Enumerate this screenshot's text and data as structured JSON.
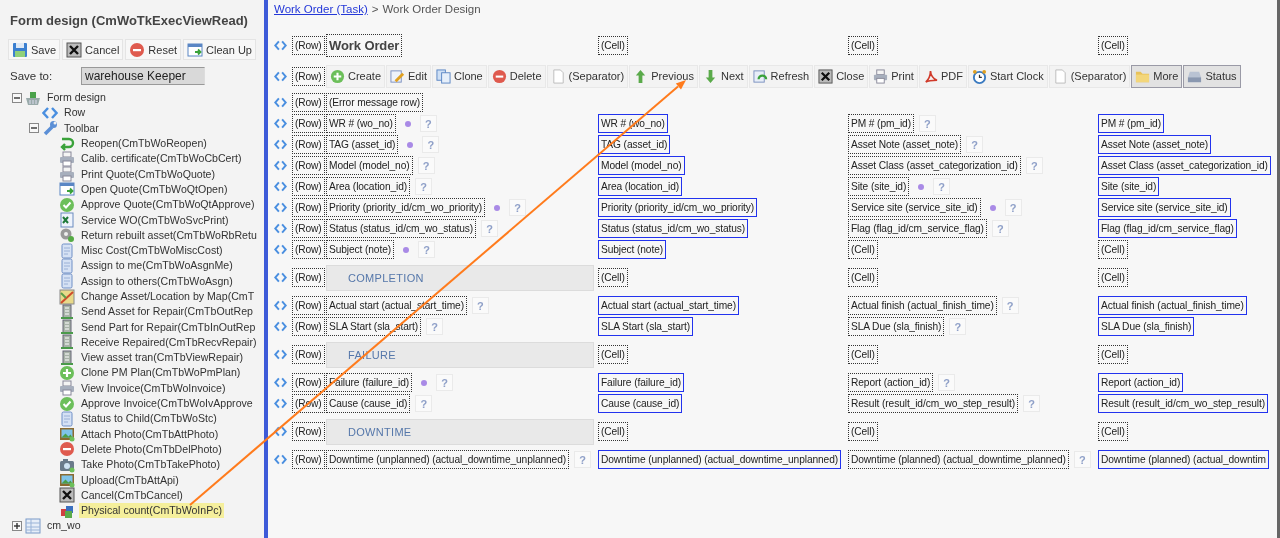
{
  "sidebar": {
    "title": "Form design (CmWoTkExecViewRead)",
    "buttons": [
      "Save",
      "Cancel",
      "Reset",
      "Clean Up"
    ],
    "save_to": {
      "label": "Save to:",
      "value": "warehouse Keeper"
    },
    "tree": [
      {
        "label": "Form design",
        "expanded": true,
        "selected": false,
        "children": [
          {
            "label": "Row",
            "selected": false
          },
          {
            "label": "Toolbar",
            "expanded": true,
            "selected": false,
            "children": [
              {
                "label": "Reopen(CmTbWoReopen)",
                "selected": false
              },
              {
                "label": "Calib. certificate(CmTbWoCbCert)",
                "selected": false
              },
              {
                "label": "Print Quote(CmTbWoQuote)",
                "selected": false
              },
              {
                "label": "Open Quote(CmTbWoQtOpen)",
                "selected": false
              },
              {
                "label": "Approve Quote(CmTbWoQtApprove)",
                "selected": false
              },
              {
                "label": "Service WO(CmTbWoSvcPrint)",
                "selected": false
              },
              {
                "label": "Return rebuilt asset(CmTbWoRbRetu",
                "selected": false
              },
              {
                "label": "Misc Cost(CmTbWoMiscCost)",
                "selected": false
              },
              {
                "label": "Assign to me(CmTbWoAsgnMe)",
                "selected": false
              },
              {
                "label": "Assign to others(CmTbWoAsgn)",
                "selected": false
              },
              {
                "label": "Change Asset/Location by Map(CmT",
                "selected": false
              },
              {
                "label": "Send Asset for Repair(CmTbOutRep",
                "selected": false
              },
              {
                "label": "Send Part for Repair(CmTbInOutRep",
                "selected": false
              },
              {
                "label": "Receive Repaired(CmTbRecvRepair)",
                "selected": false
              },
              {
                "label": "View asset tran(CmTbViewRepair)",
                "selected": false
              },
              {
                "label": "Clone PM Plan(CmTbWoPmPlan)",
                "selected": false
              },
              {
                "label": "View Invoice(CmTbWoInvoice)",
                "selected": false
              },
              {
                "label": "Approve Invoice(CmTbWoIvApprove",
                "selected": false
              },
              {
                "label": "Status to Child(CmTbWoStc)",
                "selected": false
              },
              {
                "label": "Attach Photo(CmTbAttPhoto)",
                "selected": false
              },
              {
                "label": "Delete Photo(CmTbDelPhoto)",
                "selected": false
              },
              {
                "label": "Take Photo(CmTbTakePhoto)",
                "selected": false
              },
              {
                "label": "Upload(CmTbAttApi)",
                "selected": false
              },
              {
                "label": "Cancel(CmTbCancel)",
                "selected": false
              },
              {
                "label": "Physical count(CmTbWoInPc)",
                "selected": true
              }
            ]
          }
        ]
      },
      {
        "label": "cm_wo",
        "expanded": false,
        "selected": false
      }
    ]
  },
  "breadcrumb": {
    "link": "Work Order (Task)",
    "separator": ">",
    "current": "Work Order Design"
  },
  "rows": [
    {
      "kind": "cells",
      "marker": "(Row)",
      "cells": [
        {
          "kind": "heading",
          "label": "Work Order"
        },
        {
          "kind": "label",
          "label": "(Cell)"
        },
        {
          "kind": "label",
          "label": "(Cell)"
        },
        {
          "kind": "label",
          "label": "(Cell)"
        }
      ]
    },
    {
      "kind": "toolbar",
      "marker": "(Row)",
      "buttons": [
        {
          "kind": "button",
          "label": "Create"
        },
        {
          "kind": "button",
          "label": "Edit"
        },
        {
          "kind": "button",
          "label": "Clone"
        },
        {
          "kind": "button",
          "label": "Delete"
        },
        {
          "kind": "button",
          "label": "(Separator)"
        },
        {
          "kind": "button",
          "label": "Previous"
        },
        {
          "kind": "button",
          "label": "Next"
        },
        {
          "kind": "button",
          "label": "Refresh"
        },
        {
          "kind": "button",
          "label": "Close"
        },
        {
          "kind": "button",
          "label": "Print"
        },
        {
          "kind": "button",
          "label": "PDF"
        },
        {
          "kind": "button",
          "label": "Start Clock"
        },
        {
          "kind": "button",
          "label": "(Separator)"
        },
        {
          "kind": "menu",
          "label": "More"
        },
        {
          "kind": "menu",
          "label": "Status"
        }
      ]
    },
    {
      "kind": "cells",
      "marker": "(Row)",
      "cells": [
        {
          "kind": "label",
          "label": "(Error message row)"
        }
      ]
    },
    {
      "kind": "cells",
      "marker": "(Row)",
      "cells": [
        {
          "kind": "label",
          "label": "WR # (wo_no)",
          "required": true,
          "help": "?"
        },
        {
          "kind": "field",
          "label": "WR # (wo_no)"
        },
        {
          "kind": "label",
          "label": "PM # (pm_id)",
          "required": false,
          "help": "?"
        },
        {
          "kind": "field",
          "label": "PM # (pm_id)"
        }
      ]
    },
    {
      "kind": "cells",
      "marker": "(Row)",
      "cells": [
        {
          "kind": "label",
          "label": "TAG (asset_id)",
          "required": true,
          "help": "?"
        },
        {
          "kind": "field",
          "label": "TAG (asset_id)"
        },
        {
          "kind": "label",
          "label": "Asset Note (asset_note)",
          "required": false,
          "help": "?"
        },
        {
          "kind": "field",
          "label": "Asset Note (asset_note)"
        }
      ]
    },
    {
      "kind": "cells",
      "marker": "(Row)",
      "cells": [
        {
          "kind": "label",
          "label": "Model (model_no)",
          "required": false,
          "help": "?"
        },
        {
          "kind": "field",
          "label": "Model (model_no)"
        },
        {
          "kind": "label",
          "label": "Asset Class (asset_categorization_id)",
          "required": false,
          "help": "?"
        },
        {
          "kind": "field",
          "label": "Asset Class (asset_categorization_id)"
        }
      ]
    },
    {
      "kind": "cells",
      "marker": "(Row)",
      "cells": [
        {
          "kind": "label",
          "label": "Area (location_id)",
          "required": false,
          "help": "?"
        },
        {
          "kind": "field",
          "label": "Area (location_id)"
        },
        {
          "kind": "label",
          "label": "Site (site_id)",
          "required": true,
          "help": "?"
        },
        {
          "kind": "field",
          "label": "Site (site_id)"
        }
      ]
    },
    {
      "kind": "cells",
      "marker": "(Row)",
      "cells": [
        {
          "kind": "label",
          "label": "Priority (priority_id/cm_wo_priority)",
          "required": true,
          "help": "?"
        },
        {
          "kind": "field",
          "label": "Priority (priority_id/cm_wo_priority)"
        },
        {
          "kind": "label",
          "label": "Service site (service_site_id)",
          "required": true,
          "help": "?"
        },
        {
          "kind": "field",
          "label": "Service site (service_site_id)"
        }
      ]
    },
    {
      "kind": "cells",
      "marker": "(Row)",
      "cells": [
        {
          "kind": "label",
          "label": "Status (status_id/cm_wo_status)",
          "required": false,
          "help": "?"
        },
        {
          "kind": "field",
          "label": "Status (status_id/cm_wo_status)"
        },
        {
          "kind": "label",
          "label": "Flag (flag_id/cm_service_flag)",
          "required": false,
          "help": "?"
        },
        {
          "kind": "field",
          "label": "Flag (flag_id/cm_service_flag)"
        }
      ]
    },
    {
      "kind": "cells",
      "marker": "(Row)",
      "cells": [
        {
          "kind": "label",
          "label": "Subject (note)",
          "required": true,
          "help": "?"
        },
        {
          "kind": "field",
          "label": "Subject (note)"
        },
        {
          "kind": "label",
          "label": "(Cell)"
        },
        {
          "kind": "label",
          "label": "(Cell)"
        }
      ]
    },
    {
      "kind": "section",
      "marker": "(Row)",
      "title": "COMPLETION",
      "cells": [
        {
          "kind": "label",
          "label": "(Cell)"
        },
        {
          "kind": "label",
          "label": "(Cell)"
        },
        {
          "kind": "label",
          "label": "(Cell)"
        }
      ]
    },
    {
      "kind": "cells",
      "marker": "(Row)",
      "cells": [
        {
          "kind": "label",
          "label": "Actual start (actual_start_time)",
          "required": false,
          "help": "?"
        },
        {
          "kind": "field",
          "label": "Actual start (actual_start_time)"
        },
        {
          "kind": "label",
          "label": "Actual finish (actual_finish_time)",
          "required": false,
          "help": "?"
        },
        {
          "kind": "field",
          "label": "Actual finish (actual_finish_time)"
        }
      ]
    },
    {
      "kind": "cells",
      "marker": "(Row)",
      "cells": [
        {
          "kind": "label",
          "label": "SLA Start (sla_start)",
          "required": false,
          "help": "?"
        },
        {
          "kind": "field",
          "label": "SLA Start (sla_start)"
        },
        {
          "kind": "label",
          "label": "SLA Due (sla_finish)",
          "required": false,
          "help": "?"
        },
        {
          "kind": "field",
          "label": "SLA Due (sla_finish)"
        }
      ]
    },
    {
      "kind": "section",
      "marker": "(Row)",
      "title": "FAILURE",
      "cells": [
        {
          "kind": "label",
          "label": "(Cell)"
        },
        {
          "kind": "label",
          "label": "(Cell)"
        },
        {
          "kind": "label",
          "label": "(Cell)"
        }
      ]
    },
    {
      "kind": "cells",
      "marker": "(Row)",
      "cells": [
        {
          "kind": "label",
          "label": "Failure (failure_id)",
          "required": true,
          "help": "?"
        },
        {
          "kind": "field",
          "label": "Failure (failure_id)"
        },
        {
          "kind": "label",
          "label": "Report (action_id)",
          "required": false,
          "help": "?"
        },
        {
          "kind": "field",
          "label": "Report (action_id)"
        }
      ]
    },
    {
      "kind": "cells",
      "marker": "(Row)",
      "cells": [
        {
          "kind": "label",
          "label": "Cause (cause_id)",
          "required": false,
          "help": "?"
        },
        {
          "kind": "field",
          "label": "Cause (cause_id)"
        },
        {
          "kind": "label",
          "label": "Result (result_id/cm_wo_step_result)",
          "required": false,
          "help": "?"
        },
        {
          "kind": "field",
          "label": "Result (result_id/cm_wo_step_result)"
        }
      ]
    },
    {
      "kind": "section",
      "marker": "(Row)",
      "title": "DOWNTIME",
      "cells": [
        {
          "kind": "label",
          "label": "(Cell)"
        },
        {
          "kind": "label",
          "label": "(Cell)"
        },
        {
          "kind": "label",
          "label": "(Cell)"
        }
      ]
    },
    {
      "kind": "cells",
      "marker": "(Row)",
      "cells": [
        {
          "kind": "label",
          "label": "Downtime (unplanned) (actual_downtime_unplanned)",
          "required": false,
          "help": "?"
        },
        {
          "kind": "field",
          "label": "Downtime (unplanned) (actual_downtime_unplanned)"
        },
        {
          "kind": "label",
          "label": "Downtime (planned) (actual_downtime_planned)",
          "required": false,
          "help": "?"
        },
        {
          "kind": "field",
          "label": "Downtime (planned) (actual_downtim"
        }
      ]
    }
  ]
}
